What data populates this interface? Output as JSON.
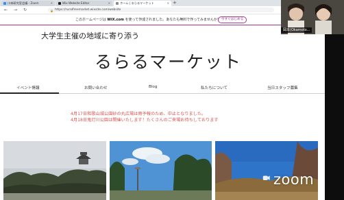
{
  "browser": {
    "tabs": [
      {
        "label": "川本研究室会議 - Zoom",
        "active": false
      },
      {
        "label": "Wix Website Editor",
        "active": false
      },
      {
        "label": "ホーム | るらるマーケット",
        "active": true
      }
    ],
    "new_tab_label": "+",
    "url": "https://ruralfreemarket.wixsite.com/website"
  },
  "wix_banner": {
    "text_before": "このホームページは",
    "brand": "WiX.com",
    "text_after": "を使って作成されました。あなたも無料で作ってみませんか？",
    "button_label": "今すぐはじめる"
  },
  "site": {
    "tagline": "大学生主催の地域に寄り添う",
    "title": "るらるマーケット",
    "menu": [
      {
        "label": "イベント情報",
        "active": true
      },
      {
        "label": "お問い合わせ",
        "active": false
      },
      {
        "label": "Blog",
        "active": false
      },
      {
        "label": "私たちについて",
        "active": false
      },
      {
        "label": "当日スタッフ募集",
        "active": false
      }
    ],
    "notice_lines": [
      "4月17日和歌山城公園砂の丸広場は雨予報のため、中止となりました。",
      "4月18日鬼灯川公園は開催いたします！たくさんのご来場お待ちしております"
    ]
  },
  "zoom": {
    "participant_name": "岡本(Okamoto...",
    "logo_text": "zoom"
  },
  "colors": {
    "wix_accent": "#9b3a8c",
    "notice_red": "#d9534f"
  }
}
